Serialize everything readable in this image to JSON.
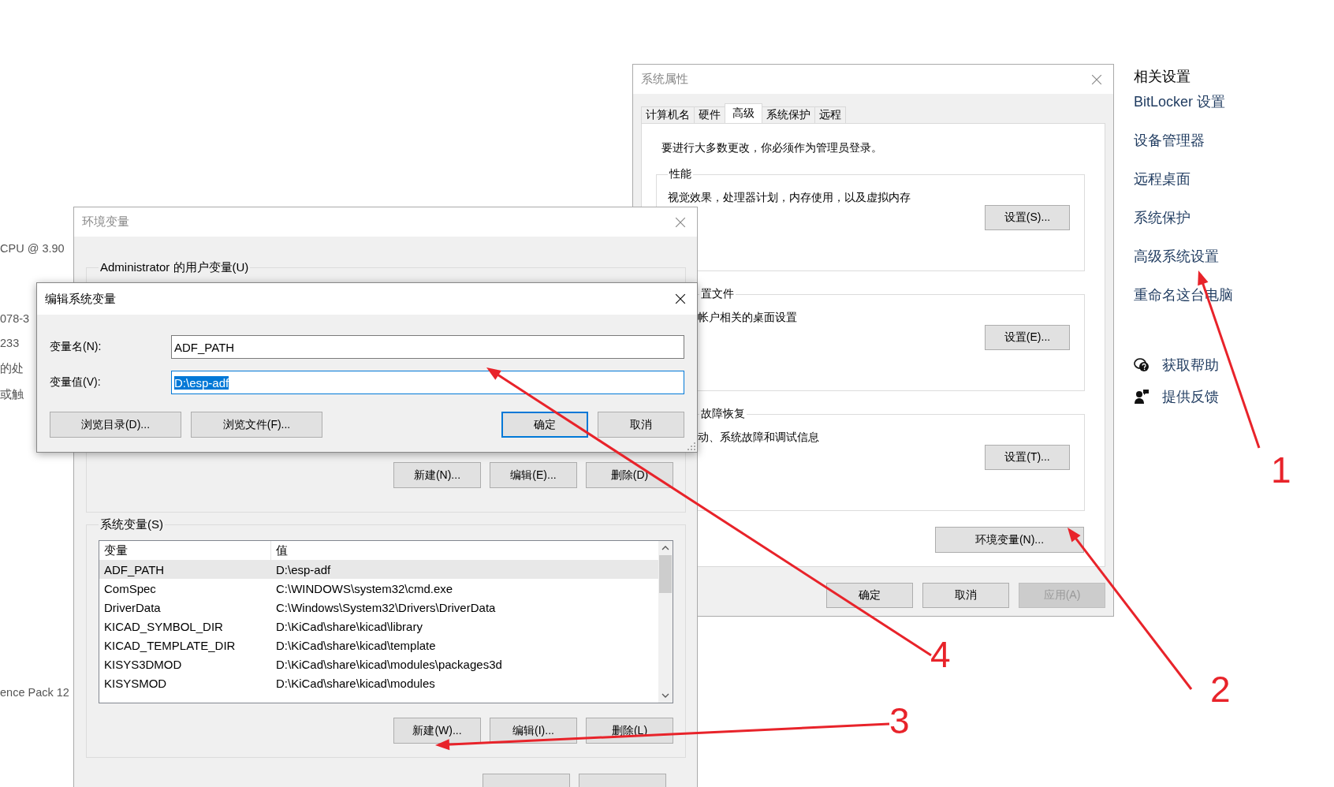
{
  "background_text": [
    "CPU @ 3.90",
    "078-3",
    "233",
    "的处",
    "或触",
    "ence Pack 12"
  ],
  "related_settings": {
    "title": "相关设置",
    "links": [
      "BitLocker 设置",
      "设备管理器",
      "远程桌面",
      "系统保护",
      "高级系统设置",
      "重命名这台电脑"
    ],
    "help": [
      {
        "kind": "help",
        "label": "获取帮助"
      },
      {
        "kind": "feedback",
        "label": "提供反馈"
      }
    ]
  },
  "system_properties": {
    "title": "系统属性",
    "tabs": [
      {
        "label": "计算机名",
        "selected": false
      },
      {
        "label": "硬件",
        "selected": false
      },
      {
        "label": "高级",
        "selected": true
      },
      {
        "label": "系统保护",
        "selected": false
      },
      {
        "label": "远程",
        "selected": false
      }
    ],
    "notice": "要进行大多数更改，你必须作为管理员登录。",
    "groups": [
      {
        "label": "性能",
        "description": "视觉效果，处理器计划，内存使用，以及虚拟内存",
        "button": "设置(S)..."
      },
      {
        "label": "置文件",
        "description": "帐户相关的桌面设置",
        "button": "设置(E)..."
      },
      {
        "label": "故障恢复",
        "description": "动、系统故障和调试信息",
        "button": "设置(T)..."
      }
    ],
    "env_button": "环境变量(N)...",
    "buttons": [
      {
        "label": "确定",
        "disabled": false
      },
      {
        "label": "取消",
        "disabled": false
      },
      {
        "label": "应用(A)",
        "disabled": true
      }
    ]
  },
  "environment_variables": {
    "title": "环境变量",
    "user_section": "Administrator 的用户变量(U)",
    "user_buttons": [
      "新建(N)...",
      "编辑(E)...",
      "删除(D)"
    ],
    "system_section": "系统变量(S)",
    "columns": [
      "变量",
      "值"
    ],
    "rows": [
      {
        "name": "ADF_PATH",
        "value": "D:\\esp-adf",
        "selected": true
      },
      {
        "name": "ComSpec",
        "value": "C:\\WINDOWS\\system32\\cmd.exe",
        "selected": false
      },
      {
        "name": "DriverData",
        "value": "C:\\Windows\\System32\\Drivers\\DriverData",
        "selected": false
      },
      {
        "name": "KICAD_SYMBOL_DIR",
        "value": "D:\\KiCad\\share\\kicad\\library",
        "selected": false
      },
      {
        "name": "KICAD_TEMPLATE_DIR",
        "value": "D:\\KiCad\\share\\kicad\\template",
        "selected": false
      },
      {
        "name": "KISYS3DMOD",
        "value": "D:\\KiCad\\share\\kicad\\modules\\packages3d",
        "selected": false
      },
      {
        "name": "KISYSMOD",
        "value": "D:\\KiCad\\share\\kicad\\modules",
        "selected": false
      }
    ],
    "system_buttons": [
      "新建(W)...",
      "编辑(I)...",
      "删除(L)"
    ]
  },
  "edit_dialog": {
    "title": "编辑系统变量",
    "fields": [
      {
        "label": "变量名(N):",
        "value": "ADF_PATH",
        "focused": false
      },
      {
        "label": "变量值(V):",
        "value": "D:\\esp-adf",
        "focused": true
      }
    ],
    "buttons": [
      {
        "label": "浏览目录(D)...",
        "default": false
      },
      {
        "label": "浏览文件(F)...",
        "default": false
      },
      {
        "label": "确定",
        "default": true
      },
      {
        "label": "取消",
        "default": false
      }
    ]
  },
  "annotations": [
    {
      "number": "1"
    },
    {
      "number": "2"
    },
    {
      "number": "3"
    },
    {
      "number": "4"
    }
  ]
}
